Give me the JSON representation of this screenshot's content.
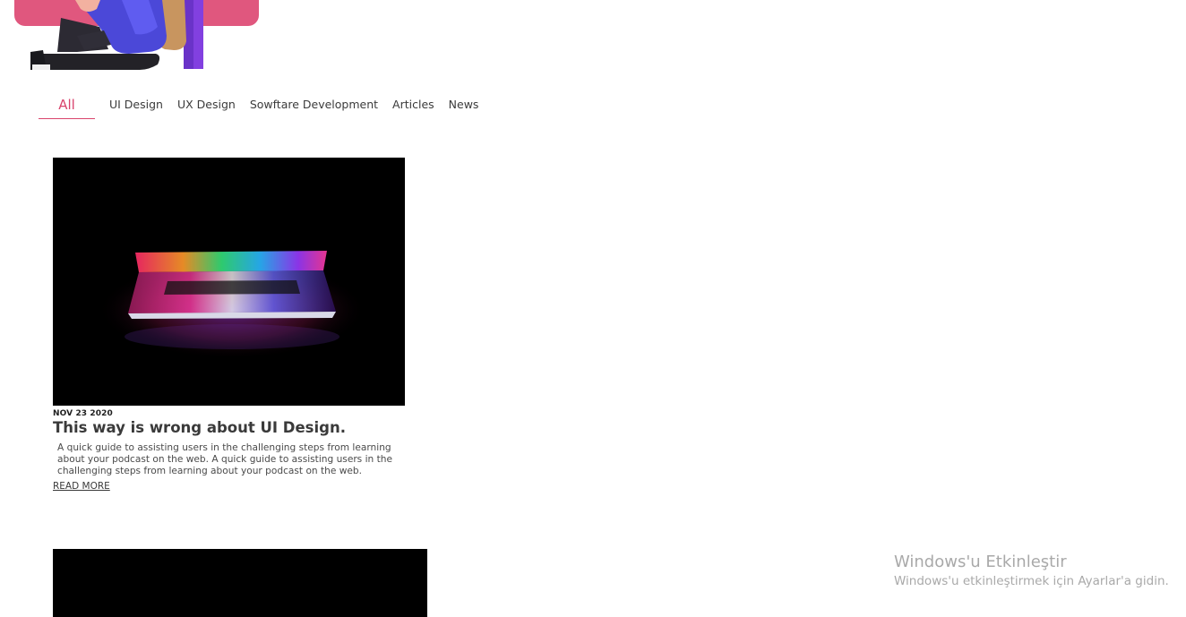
{
  "tabs": [
    {
      "label": "All",
      "active": true
    },
    {
      "label": "UI Design",
      "active": false
    },
    {
      "label": "UX Design",
      "active": false
    },
    {
      "label": "Sowftare Development",
      "active": false
    },
    {
      "label": "Articles",
      "active": false
    },
    {
      "label": "News",
      "active": false
    }
  ],
  "post": {
    "date": "NOV 23 2020",
    "title": "This way is wrong about UI Design.",
    "excerpt": "A quick guide to assisting users in the challenging steps from learning about your podcast on the web. A quick guide to assisting users in the challenging steps from learning about your podcast on the web.",
    "read_more": "READ MORE"
  },
  "watermark": {
    "title": "Windows'u Etkinleştir",
    "subtitle": "Windows'u etkinleştirmek için Ayarlar'a gidin."
  },
  "colors": {
    "accent": "#d9446d",
    "hero_band": "#e0577e"
  }
}
